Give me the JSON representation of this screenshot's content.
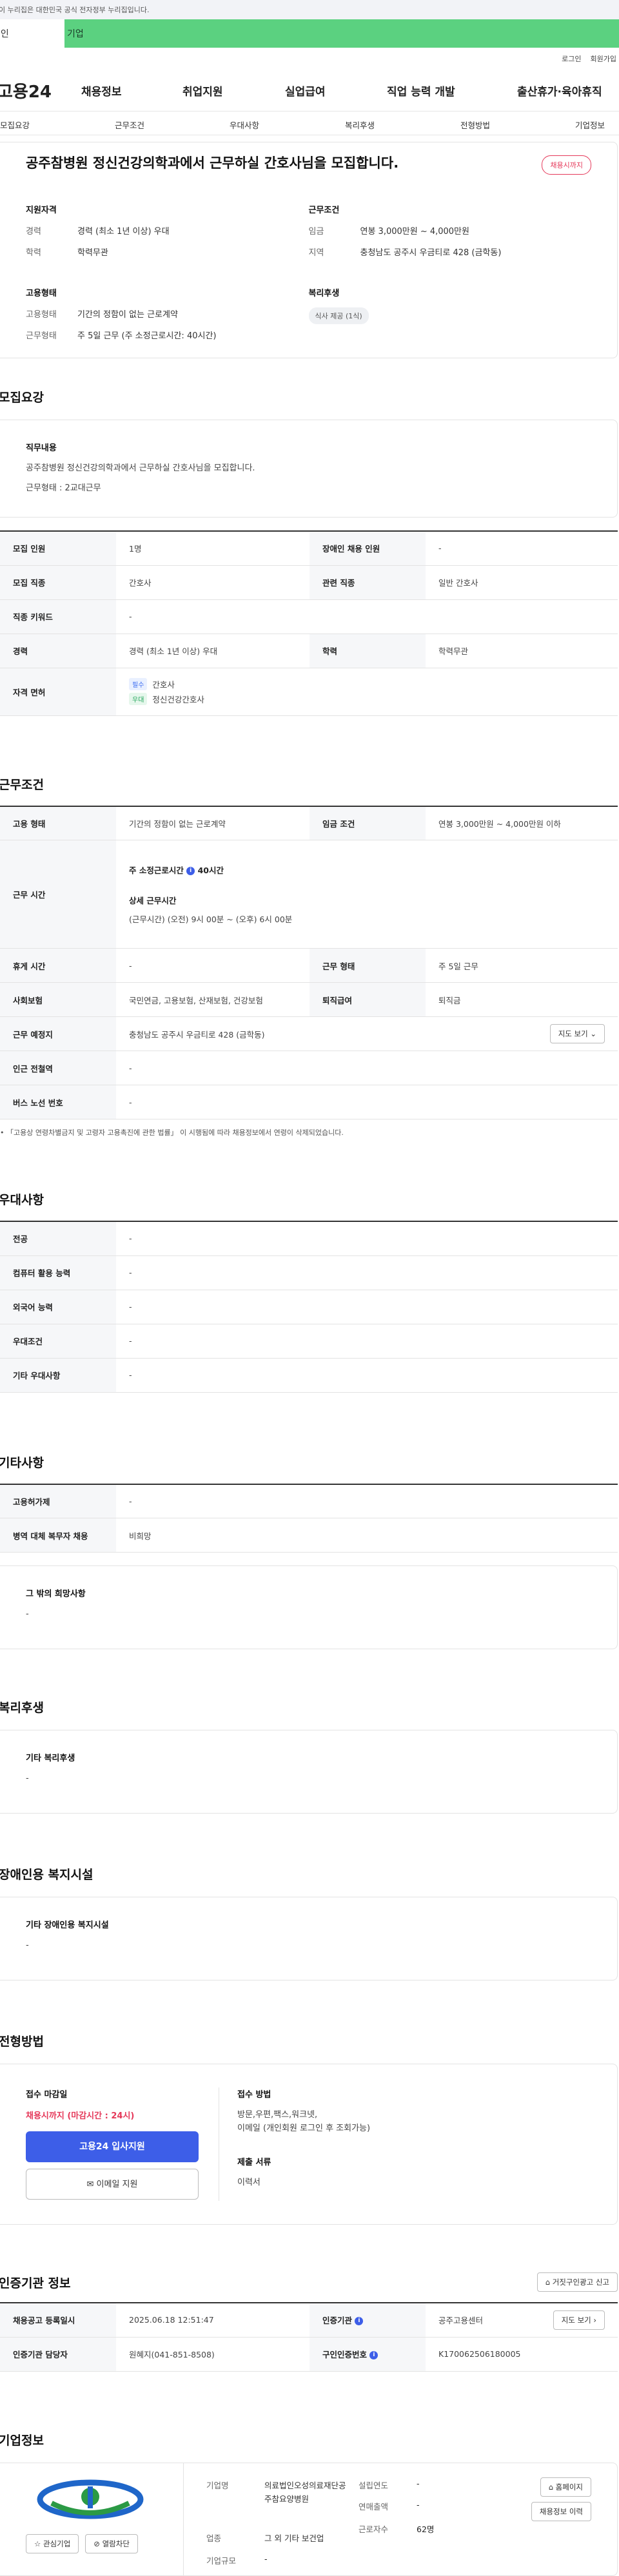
{
  "topbar": {
    "notice": "이 누리집은 대한민국 공식 전자정부 누리집입니다."
  },
  "usertabs": {
    "person": "개인",
    "company": "기업"
  },
  "util": {
    "login": "로그인",
    "join": "회원가입"
  },
  "gnb": {
    "logo": "고용24",
    "menus": [
      "채용정보",
      "취업지원",
      "실업급여",
      "직업 능력 개발",
      "출산휴가·육아휴직"
    ]
  },
  "subnav": [
    "모집요강",
    "근무조건",
    "우대사항",
    "복리후생",
    "전형방법",
    "기업정보"
  ],
  "summary": {
    "title": "공주참병원 정신건강의학과에서 근무하실 간호사님을 모집합니다.",
    "badge": "채용시까지",
    "qualification": {
      "heading": "지원자격",
      "career_k": "경력",
      "career_v": "경력 (최소 1년 이상) 우대",
      "edu_k": "학력",
      "edu_v": "학력무관"
    },
    "condition": {
      "heading": "근무조건",
      "wage_k": "임금",
      "wage_v": "연봉 3,000만원 ~ 4,000만원",
      "loc_k": "지역",
      "loc_v": "충청남도 공주시 우금티로 428 (금학동)"
    },
    "employment": {
      "heading": "고용형태",
      "type_k": "고용형태",
      "type_v": "기간의 정함이 없는 근로계약",
      "work_k": "근무형태",
      "work_v": "주 5일 근무 (주 소정근로시간: 40시간)"
    },
    "welfare": {
      "heading": "복리후생",
      "tag": "식사 제공 (1식)"
    }
  },
  "recruit": {
    "heading": "모집요강",
    "duty_heading": "직무내용",
    "duty_text": "공주참병원 정신건강의학과에서 근무하실 간호사님을 모집합니다.",
    "duty_text2": "근무형태 : 2교대근무",
    "rows": {
      "count_k": "모집 인원",
      "count_v": "1명",
      "disabled_k": "장애인 채용 인원",
      "disabled_v": "-",
      "job_k": "모집 직종",
      "job_v": "간호사",
      "related_k": "관련 직종",
      "related_v": "일반 간호사",
      "keyword_k": "직종 키워드",
      "keyword_v": "-",
      "career_k": "경력",
      "career_v": "경력 (최소 1년 이상) 우대",
      "edu_k": "학력",
      "edu_v": "학력무관",
      "license_k": "자격 면허",
      "license_tag1": "필수",
      "license_1": "간호사",
      "license_tag2": "우대",
      "license_2": "정신건강간호사"
    }
  },
  "work": {
    "heading": "근무조건",
    "emp_k": "고용 형태",
    "emp_v": "기간의 정함이 없는 근로계약",
    "wage_k": "임금 조건",
    "wage_v": "연봉 3,000만원 ~ 4,000만원 이하",
    "hours_k": "근무 시간",
    "hours_title": "주 소정근로시간",
    "hours_value": "40시간",
    "hours_detail_title": "상세 근무시간",
    "hours_detail": "(근무시간) (오전) 9시 00분 ~ (오후) 6시 00분",
    "rest_k": "휴게 시간",
    "rest_v": "-",
    "form_k": "근무 형태",
    "form_v": "주 5일 근무",
    "insurance_k": "사회보험",
    "insurance_v": "국민연금, 고용보험, 산재보험, 건강보험",
    "severance_k": "퇴직급여",
    "severance_v": "퇴직금",
    "place_k": "근무 예정지",
    "place_v": "충청남도 공주시 우금티로 428 (금학동)",
    "map_btn": "지도 보기",
    "station_k": "인근 전철역",
    "station_v": "-",
    "bus_k": "버스 노선 번호",
    "bus_v": "-",
    "note": "「고용상 연령차별금지 및 고령자 고용촉진에 관한 법률」 이 시행됨에 따라 채용정보에서 연령이 삭제되었습니다."
  },
  "prefer": {
    "heading": "우대사항",
    "major_k": "전공",
    "major_v": "-",
    "computer_k": "컴퓨터 활용 능력",
    "computer_v": "-",
    "lang_k": "외국어 능력",
    "lang_v": "-",
    "cond_k": "우대조건",
    "cond_v": "-",
    "etc_k": "기타 우대사항",
    "etc_v": "-"
  },
  "other": {
    "heading": "기타사항",
    "subsidy_k": "고용허가제",
    "subsidy_v": "-",
    "military_k": "병역 대체 복무자 채용",
    "military_v": "비희망",
    "wish_heading": "그 밖의 희망사항",
    "wish_v": "-"
  },
  "welfare": {
    "heading": "복리후생",
    "sub": "기타 복리후생",
    "v": "-"
  },
  "facility": {
    "heading": "장애인용 복지시설",
    "sub": "기타 장애인용 복지시설",
    "v": "-"
  },
  "process": {
    "heading": "전형방법",
    "deadline_k": "접수 마감일",
    "deadline_v": "채용시까지 (마감시간 : 24시)",
    "apply_btn": "고용24 입사지원",
    "email_btn": "이메일 지원",
    "method_k": "접수 방법",
    "method_v1": "방문,우편,팩스,워크넷,",
    "method_v2": "이메일 (개인회원 로그인 후 조회가능)",
    "docs_k": "제출 서류",
    "docs_v": "이력서"
  },
  "agency": {
    "heading": "인증기관 정보",
    "report_btn": "거짓구인광고 신고",
    "reg_k": "채용공고 등록일시",
    "reg_v": "2025.06.18 12:51:47",
    "org_k": "인증기관",
    "org_v": "공주고용센터",
    "map_btn": "지도 보기",
    "staff_k": "인증기관 담당자",
    "staff_v": "원혜지(041-851-8508)",
    "num_k": "구인인증번호",
    "num_v": "K170062506180005"
  },
  "company": {
    "heading": "기업정보",
    "fav_btn": "관심기업",
    "block_btn": "열람차단",
    "name_k": "기업명",
    "name_v": "의료법인오성의료재단공주참요양병원",
    "year_k": "설립연도",
    "year_v": "-",
    "sales_k": "연매출액",
    "sales_v": "-",
    "industry_k": "업종",
    "industry_v": "그 외 기타 보건업",
    "staff_k": "근로자수",
    "staff_v": "62명",
    "size_k": "기업규모",
    "size_v": "-",
    "home_btn": "홈페이지",
    "history_btn": "채용정보 이력"
  },
  "colors": {
    "accent": "#3d5ee8",
    "brand_green": "#5bd180",
    "deadline_red": "#e5395a"
  }
}
